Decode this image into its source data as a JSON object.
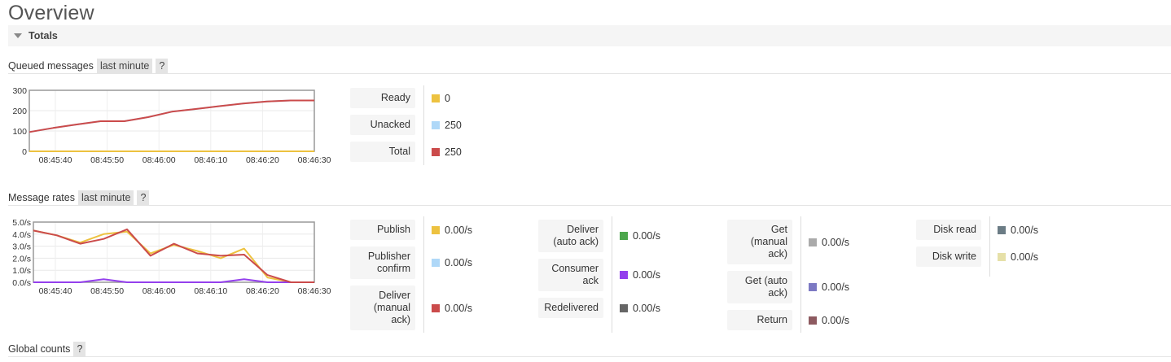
{
  "page": {
    "title": "Overview"
  },
  "totals": {
    "label": "Totals"
  },
  "queued": {
    "title": "Queued messages",
    "range": "last minute",
    "help": "?",
    "legend": [
      {
        "label": "Ready",
        "value": "0",
        "color": "#edc240"
      },
      {
        "label": "Unacked",
        "value": "250",
        "color": "#afd8f8"
      },
      {
        "label": "Total",
        "value": "250",
        "color": "#cb4b4b"
      }
    ]
  },
  "rates": {
    "title": "Message rates",
    "range": "last minute",
    "help": "?",
    "groups": [
      [
        {
          "label": "Publish",
          "value": "0.00/s",
          "color": "#edc240"
        },
        {
          "label": "Publisher confirm",
          "value": "0.00/s",
          "color": "#afd8f8"
        },
        {
          "label": "Deliver (manual ack)",
          "value": "0.00/s",
          "color": "#cb4b4b"
        }
      ],
      [
        {
          "label": "Deliver (auto ack)",
          "value": "0.00/s",
          "color": "#4da74d"
        },
        {
          "label": "Consumer ack",
          "value": "0.00/s",
          "color": "#9440ed"
        },
        {
          "label": "Redelivered",
          "value": "0.00/s",
          "color": "#666666"
        }
      ],
      [
        {
          "label": "Get (manual ack)",
          "value": "0.00/s",
          "color": "#aaaaaa"
        },
        {
          "label": "Get (auto ack)",
          "value": "0.00/s",
          "color": "#7c79c3"
        },
        {
          "label": "Return",
          "value": "0.00/s",
          "color": "#8d5a60"
        }
      ],
      [
        {
          "label": "Disk read",
          "value": "0.00/s",
          "color": "#6b7c85"
        },
        {
          "label": "Disk write",
          "value": "0.00/s",
          "color": "#e6e0a8"
        }
      ]
    ]
  },
  "global": {
    "title": "Global counts",
    "help": "?"
  },
  "chart_data": [
    {
      "type": "line",
      "xticks": [
        "08:45:40",
        "08:45:50",
        "08:46:00",
        "08:46:10",
        "08:46:20",
        "08:46:30"
      ],
      "x": [
        0,
        5,
        10,
        15,
        20,
        25,
        30,
        35,
        40,
        45,
        50,
        55,
        60
      ],
      "xlim": [
        0,
        60
      ],
      "yticks": [
        "0",
        "100",
        "200",
        "300"
      ],
      "ylim": [
        0,
        300
      ],
      "series": [
        {
          "name": "Ready",
          "color": "#edc240",
          "values": [
            0,
            0,
            0,
            0,
            0,
            0,
            0,
            0,
            0,
            0,
            0,
            0,
            0
          ]
        },
        {
          "name": "Unacked",
          "color": "#afd8f8",
          "values": [
            95,
            115,
            132,
            148,
            148,
            168,
            195,
            208,
            222,
            235,
            245,
            250,
            250
          ]
        },
        {
          "name": "Total",
          "color": "#cb4b4b",
          "values": [
            95,
            115,
            132,
            148,
            148,
            168,
            195,
            208,
            222,
            235,
            245,
            250,
            250
          ]
        }
      ]
    },
    {
      "type": "line",
      "xticks": [
        "08:45:40",
        "08:45:50",
        "08:46:00",
        "08:46:10",
        "08:46:20",
        "08:46:30"
      ],
      "x": [
        0,
        5,
        10,
        15,
        20,
        25,
        30,
        35,
        40,
        45,
        50,
        55,
        60
      ],
      "xlim": [
        0,
        60
      ],
      "yticks": [
        "0.0/s",
        "1.0/s",
        "2.0/s",
        "3.0/s",
        "4.0/s",
        "5.0/s"
      ],
      "ylim": [
        0,
        5
      ],
      "series": [
        {
          "name": "Publish",
          "color": "#edc240",
          "values": [
            4.3,
            3.9,
            3.3,
            4.0,
            4.2,
            2.4,
            3.1,
            2.6,
            2.0,
            2.8,
            0.4,
            0,
            0
          ]
        },
        {
          "name": "Consumer ack",
          "color": "#9440ed",
          "values": [
            0,
            0,
            0,
            0.25,
            0,
            0,
            0,
            0,
            0,
            0.25,
            0,
            0,
            0
          ]
        },
        {
          "name": "Deliver (manual ack)",
          "color": "#cb4b4b",
          "values": [
            4.3,
            3.9,
            3.2,
            3.6,
            4.4,
            2.2,
            3.2,
            2.4,
            2.2,
            2.3,
            0.6,
            0,
            0
          ]
        }
      ]
    }
  ]
}
